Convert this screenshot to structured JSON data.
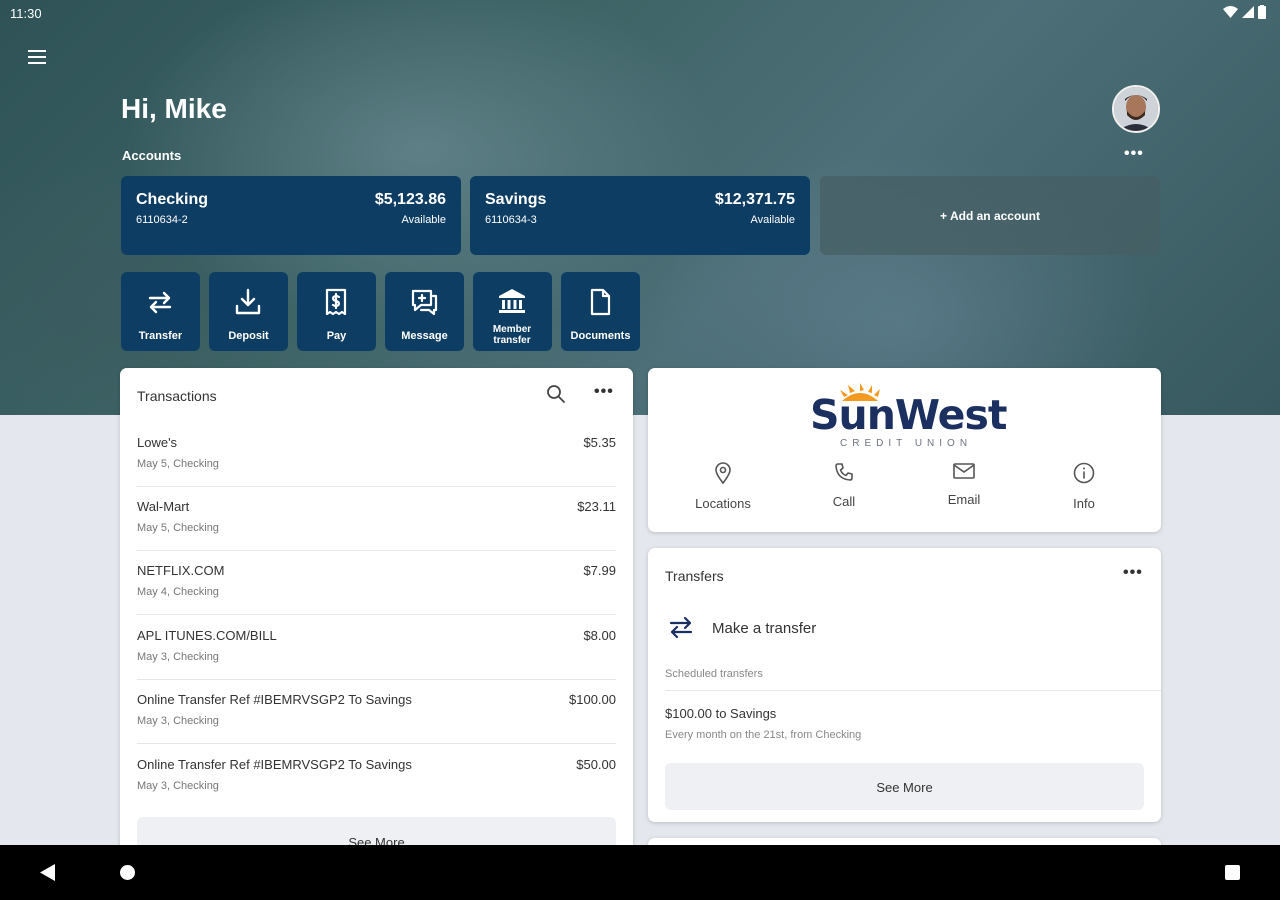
{
  "status": {
    "time": "11:30"
  },
  "header": {
    "greeting": "Hi, Mike",
    "accounts_label": "Accounts",
    "more": "•••"
  },
  "accounts": [
    {
      "name": "Checking",
      "number": "6110634-2",
      "balance": "$5,123.86",
      "status": "Available"
    },
    {
      "name": "Savings",
      "number": "6110634-3",
      "balance": "$12,371.75",
      "status": "Available"
    }
  ],
  "add_account": "+ Add an account",
  "actions": [
    {
      "label": "Transfer",
      "icon": "transfer-icon"
    },
    {
      "label": "Deposit",
      "icon": "deposit-icon"
    },
    {
      "label": "Pay",
      "icon": "pay-icon"
    },
    {
      "label": "Message",
      "icon": "message-icon"
    },
    {
      "label": "Member transfer",
      "icon": "bank-icon"
    },
    {
      "label": "Documents",
      "icon": "document-icon"
    }
  ],
  "transactions": {
    "title": "Transactions",
    "more": "•••",
    "rows": [
      {
        "name": "Lowe's",
        "sub": "May 5, Checking",
        "amount": "$5.35"
      },
      {
        "name": "Wal-Mart",
        "sub": "May 5, Checking",
        "amount": "$23.11"
      },
      {
        "name": "NETFLIX.COM",
        "sub": "May 4, Checking",
        "amount": "$7.99"
      },
      {
        "name": "APL ITUNES.COM/BILL",
        "sub": "May 3, Checking",
        "amount": "$8.00"
      },
      {
        "name": "Online Transfer Ref #IBEMRVSGP2 To Savings",
        "sub": "May 3, Checking",
        "amount": "$100.00"
      },
      {
        "name": "Online Transfer Ref #IBEMRVSGP2 To Savings",
        "sub": "May 3, Checking",
        "amount": "$50.00"
      }
    ],
    "see_more": "See More"
  },
  "brand": {
    "name": "SunWest",
    "tagline": "CREDIT UNION",
    "contacts": [
      {
        "label": "Locations",
        "icon": "location-pin-icon"
      },
      {
        "label": "Call",
        "icon": "phone-icon"
      },
      {
        "label": "Email",
        "icon": "email-icon"
      },
      {
        "label": "Info",
        "icon": "info-icon"
      }
    ]
  },
  "transfers": {
    "title": "Transfers",
    "more": "•••",
    "make": "Make a transfer",
    "scheduled_label": "Scheduled transfers",
    "item": "$100.00 to Savings",
    "item_sub": "Every month on the 21st, from Checking",
    "see_more": "See More"
  },
  "colors": {
    "brand_navy": "#0e3d64",
    "sun_orange": "#f29a1f",
    "background": "#e4e8ee"
  }
}
